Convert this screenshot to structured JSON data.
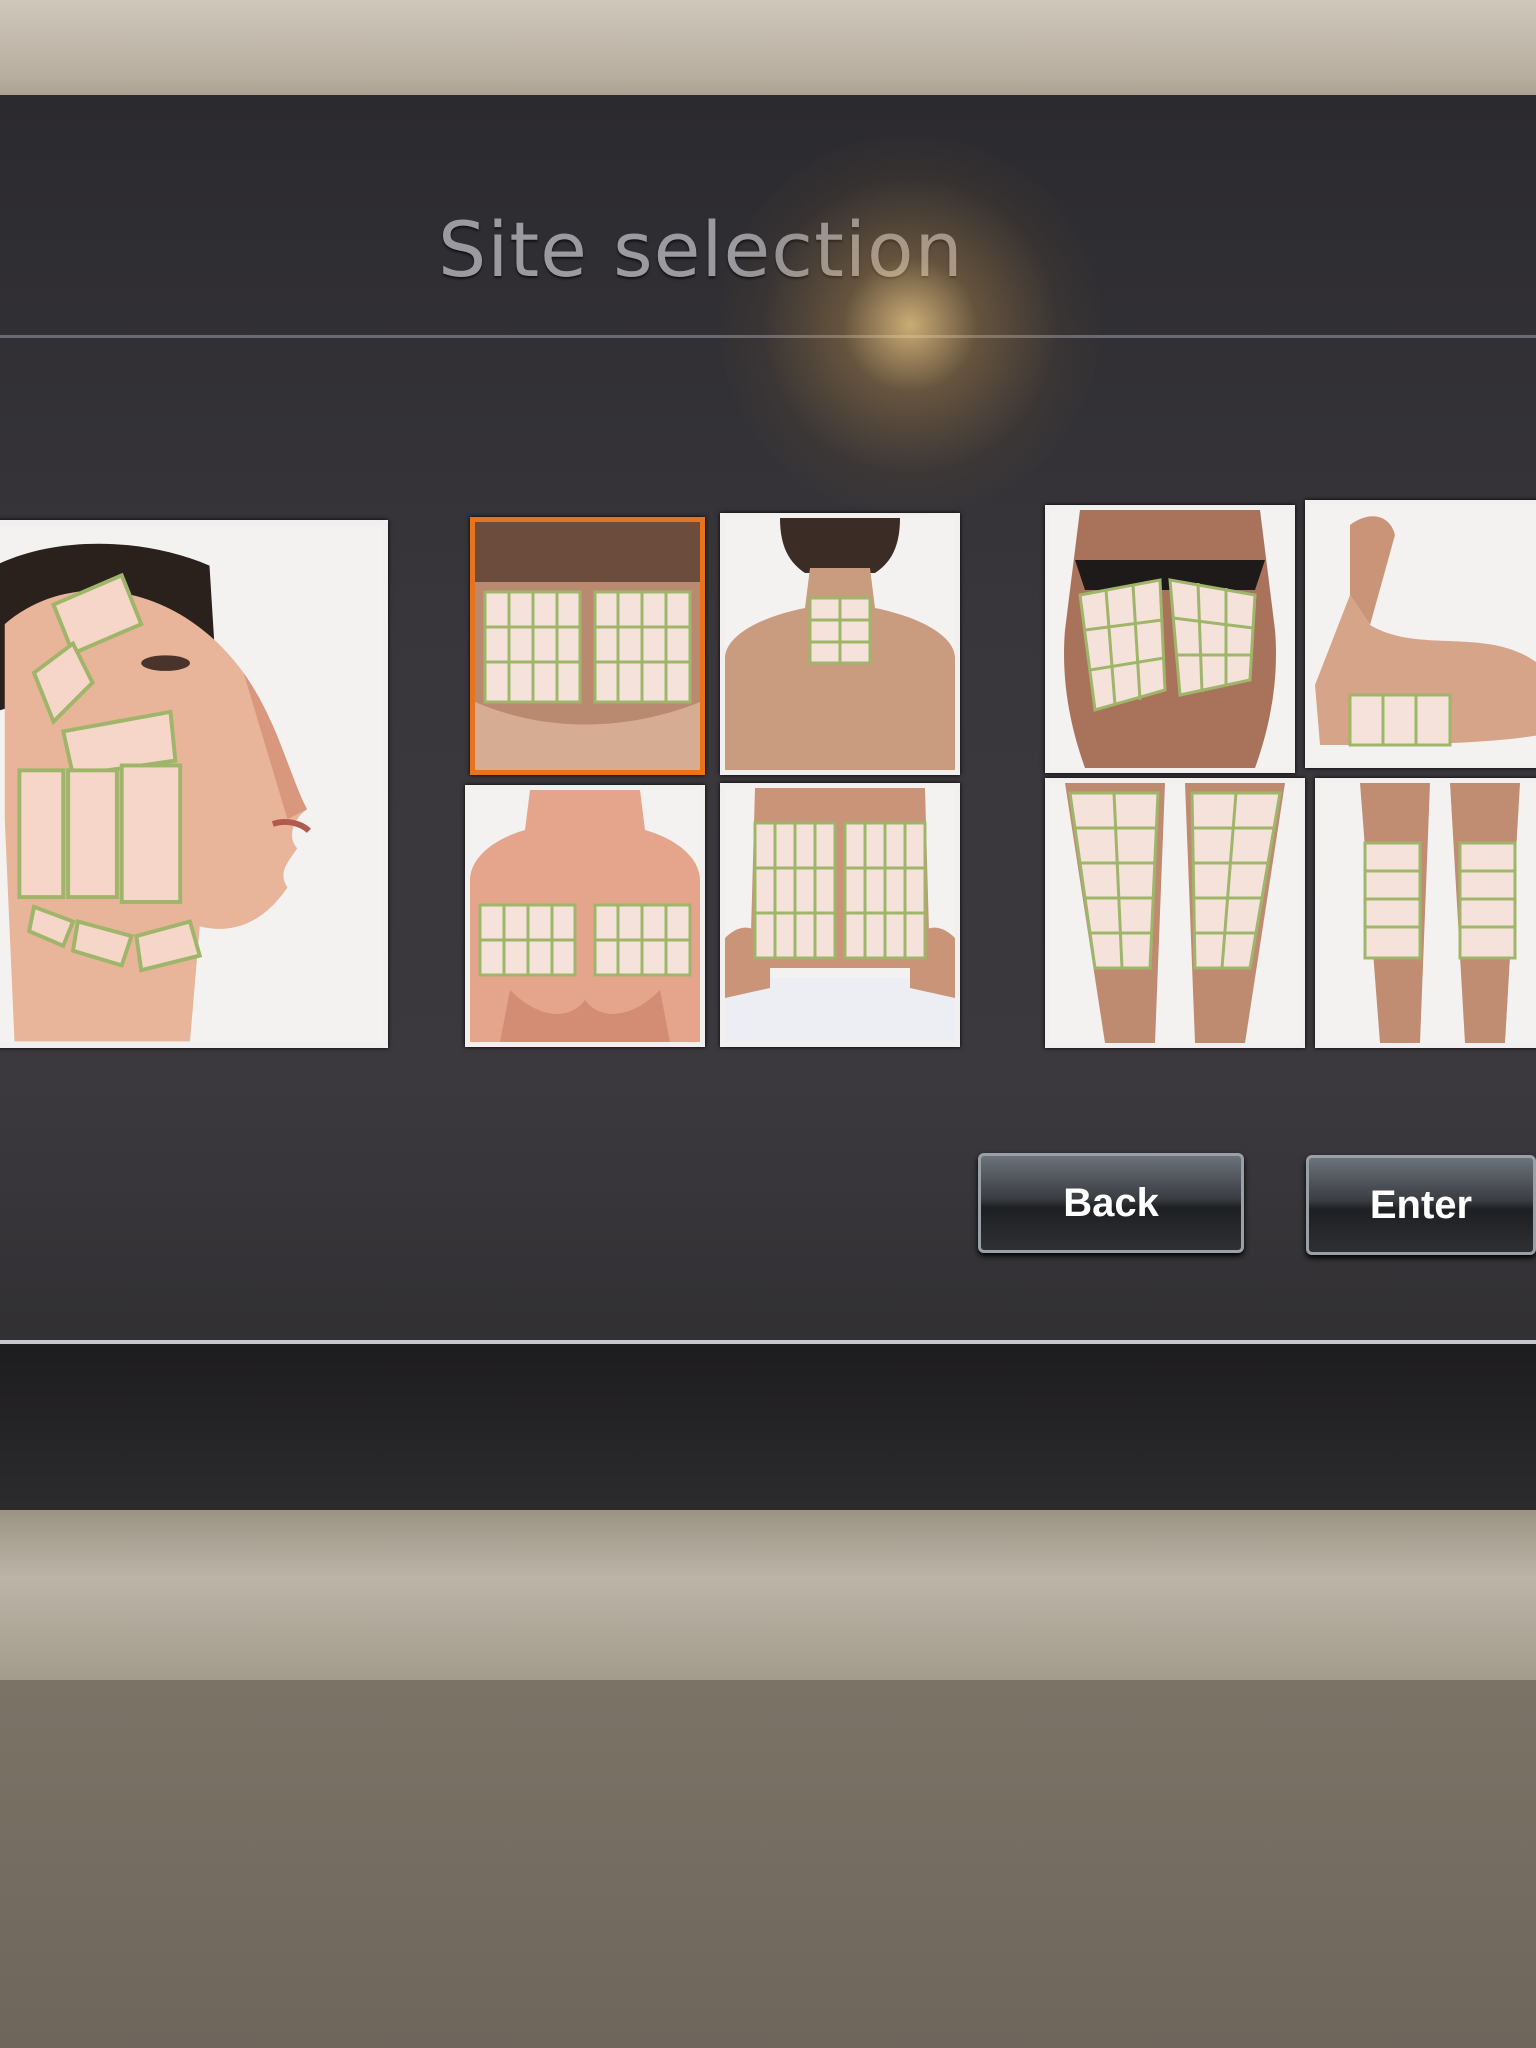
{
  "screen": {
    "title": "Site selection",
    "accent_color": "#e8731a"
  },
  "sites": [
    {
      "name": "face-neck",
      "selected": false
    },
    {
      "name": "upper-back",
      "selected": true
    },
    {
      "name": "nape",
      "selected": false
    },
    {
      "name": "chest",
      "selected": false
    },
    {
      "name": "abdomen",
      "selected": false
    },
    {
      "name": "buttocks",
      "selected": false
    },
    {
      "name": "upper-arm",
      "selected": false
    },
    {
      "name": "thighs",
      "selected": false
    },
    {
      "name": "calves",
      "selected": false
    }
  ],
  "buttons": {
    "back_label": "Back",
    "enter_label": "Enter"
  }
}
